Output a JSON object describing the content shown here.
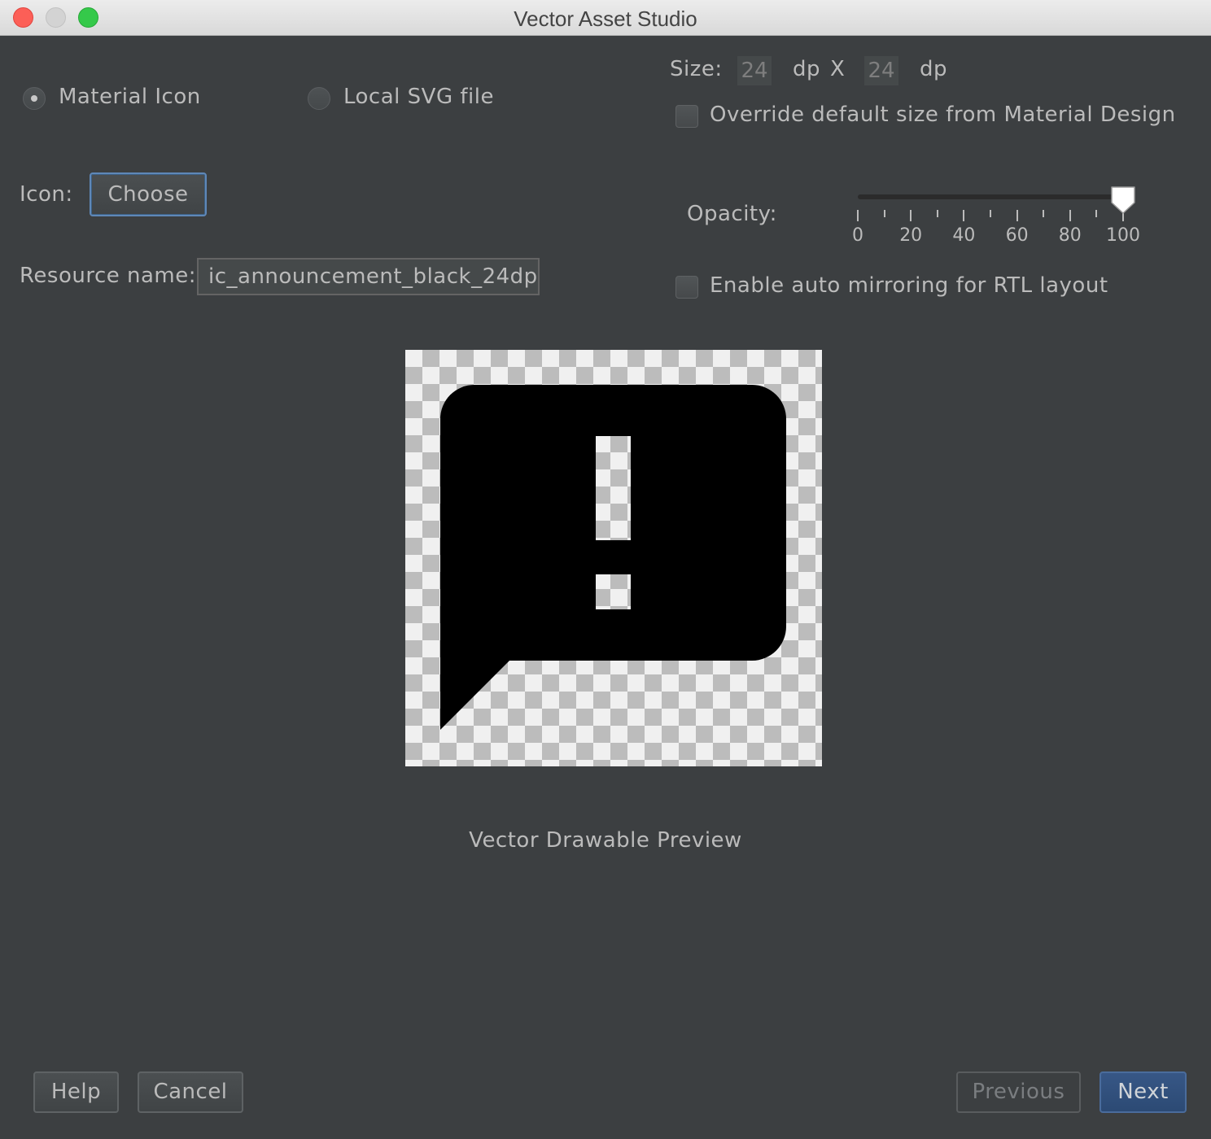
{
  "window": {
    "title": "Vector Asset Studio"
  },
  "source_type": {
    "material_icon_label": "Material Icon",
    "local_svg_label": "Local SVG file",
    "selected": "Material Icon"
  },
  "icon": {
    "label": "Icon:",
    "choose_label": "Choose",
    "icon_name": "announcement-icon"
  },
  "resource": {
    "label": "Resource name:",
    "value": "ic_announcement_black_24dp"
  },
  "size": {
    "label": "Size:",
    "width": "24",
    "width_unit": "dp",
    "separator": "X",
    "height": "24",
    "height_unit": "dp"
  },
  "override": {
    "label": "Override default size from Material Design",
    "checked": false
  },
  "opacity": {
    "label": "Opacity:",
    "value": 100,
    "min": 0,
    "max": 100,
    "tick_labels": [
      "0",
      "20",
      "40",
      "60",
      "80",
      "100"
    ]
  },
  "auto_mirror": {
    "label": "Enable auto mirroring for RTL layout",
    "checked": false
  },
  "preview": {
    "caption": "Vector Drawable Preview"
  },
  "footer": {
    "help_label": "Help",
    "cancel_label": "Cancel",
    "previous_label": "Previous",
    "next_label": "Next"
  },
  "colors": {
    "background": "#3c3f41",
    "text": "#bbbbbb",
    "accent": "#375786"
  }
}
